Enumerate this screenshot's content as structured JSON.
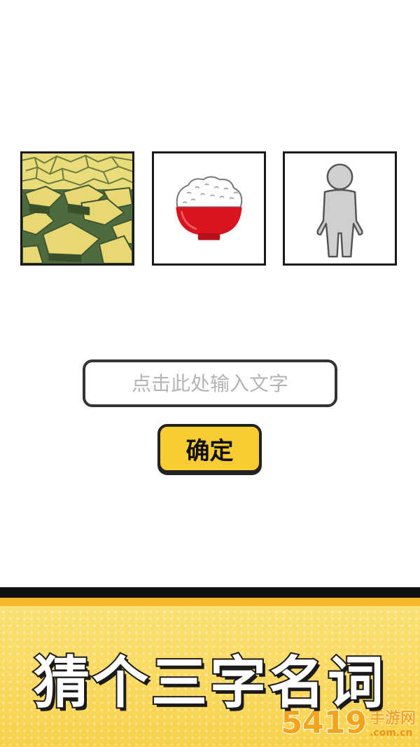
{
  "puzzle": {
    "tiles": [
      {
        "icon": "cracked-dry-land-icon"
      },
      {
        "icon": "rice-bowl-icon"
      },
      {
        "icon": "gray-person-icon"
      }
    ]
  },
  "answer_input": {
    "placeholder": "点击此处输入文字",
    "value": ""
  },
  "confirm_button": {
    "label": "确定"
  },
  "banner": {
    "slogan": "猜个三字名词"
  },
  "watermark": {
    "number": "5419",
    "site_name": "手游网",
    "domain": ".com.cn"
  },
  "colors": {
    "button_yellow": "#f9cc33",
    "banner_yellow": "#f8d24c",
    "banner_stripe": "#f7b72a",
    "land_green": "#4f6a3f",
    "land_yellow": "#e7d873",
    "bowl_red": "#d8141f"
  }
}
